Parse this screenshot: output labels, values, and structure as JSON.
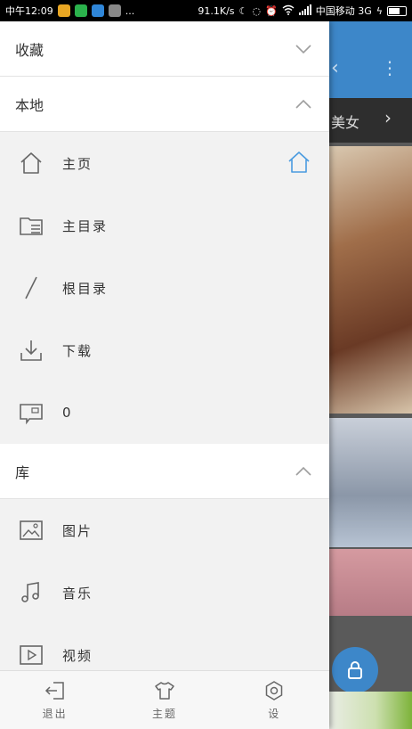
{
  "status_bar": {
    "time": "中午12:09",
    "dots": "...",
    "speed": "91.1K/s",
    "carrier": "中国移动 3G"
  },
  "background": {
    "tab_label": "美女"
  },
  "drawer": {
    "sections": [
      {
        "title": "收藏",
        "expanded": false,
        "chevron_icon": "chevron-down-icon"
      },
      {
        "title": "本地",
        "expanded": true,
        "chevron_icon": "chevron-up-icon"
      },
      {
        "title": "库",
        "expanded": true,
        "chevron_icon": "chevron-up-icon"
      }
    ],
    "local_items": [
      {
        "label": "主页",
        "icon": "home-icon"
      },
      {
        "label": "主目录",
        "icon": "folder-list-icon"
      },
      {
        "label": "根目录",
        "icon": "slash-icon"
      },
      {
        "label": "下载",
        "icon": "download-icon"
      },
      {
        "label": "0",
        "icon": "sd-card-icon"
      }
    ],
    "library_items": [
      {
        "label": "图片",
        "icon": "image-icon"
      },
      {
        "label": "音乐",
        "icon": "music-icon"
      },
      {
        "label": "视频",
        "icon": "video-icon"
      }
    ],
    "accent_color": "#4a9be0"
  },
  "toolbar": {
    "exit_label": "退出",
    "theme_label": "主题",
    "settings_label": "设"
  }
}
